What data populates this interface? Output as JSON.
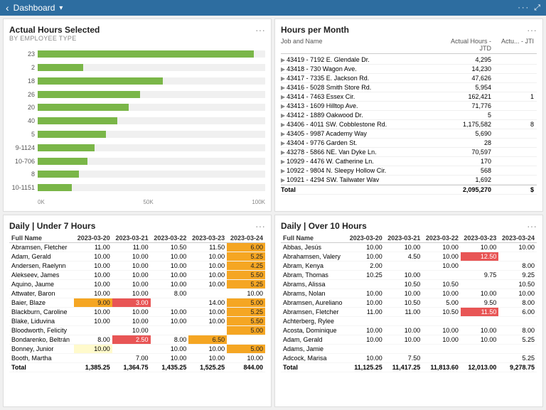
{
  "topbar": {
    "back": "‹",
    "title": "Dashboard",
    "chevron": "▾",
    "dots": "···",
    "expand": "⤢"
  },
  "actualHours": {
    "title": "Actual Hours Selected",
    "subtitle": "BY EMPLOYEE TYPE",
    "bars": [
      {
        "label": "23",
        "value": 95,
        "max": 100
      },
      {
        "label": "2",
        "value": 20,
        "max": 100
      },
      {
        "label": "18",
        "value": 55,
        "max": 100
      },
      {
        "label": "26",
        "value": 45,
        "max": 100
      },
      {
        "label": "20",
        "value": 40,
        "max": 100
      },
      {
        "label": "40",
        "value": 35,
        "max": 100
      },
      {
        "label": "5",
        "value": 30,
        "max": 100
      },
      {
        "label": "9-1124",
        "value": 25,
        "max": 100
      },
      {
        "label": "10-706",
        "value": 22,
        "max": 100
      },
      {
        "label": "8",
        "value": 18,
        "max": 100
      },
      {
        "label": "10-1151",
        "value": 15,
        "max": 100
      }
    ],
    "axis": [
      "0K",
      "50K",
      "100K"
    ]
  },
  "hoursPerMonth": {
    "title": "Hours per Month",
    "col1": "Job and Name",
    "col2": "Actual Hours - JTD",
    "col2short": "Actu... - JTD",
    "col3": "Actu... - JTI",
    "rows": [
      {
        "id": "43419",
        "name": "7192 E. Glendale Dr.",
        "actual": "4,295",
        "actu2": ""
      },
      {
        "id": "43418",
        "name": "730 Wagon Ave.",
        "actual": "14,230",
        "actu2": ""
      },
      {
        "id": "43417",
        "name": "7335 E. Jackson Rd.",
        "actual": "47,626",
        "actu2": ""
      },
      {
        "id": "43416",
        "name": "5028 Smith Store Rd.",
        "actual": "5,954",
        "actu2": ""
      },
      {
        "id": "43414",
        "name": "7463 Essex Cir.",
        "actual": "162,421",
        "actu2": "1"
      },
      {
        "id": "43413",
        "name": "1609 Hilltop Ave.",
        "actual": "71,776",
        "actu2": ""
      },
      {
        "id": "43412",
        "name": "1889 Oakwood Dr.",
        "actual": "5",
        "actu2": ""
      },
      {
        "id": "43406",
        "name": "4011 SW. Cobblestone Rd.",
        "actual": "1,175,582",
        "actu2": "8"
      },
      {
        "id": "43405",
        "name": "9987 Academy Way",
        "actual": "5,690",
        "actu2": ""
      },
      {
        "id": "43404",
        "name": "9776 Garden St.",
        "actual": "28",
        "actu2": ""
      },
      {
        "id": "43278",
        "name": "5866 NE. Van Dyke Ln.",
        "actual": "70,597",
        "actu2": ""
      },
      {
        "id": "10929",
        "name": "4476 W. Catherine Ln.",
        "actual": "170",
        "actu2": ""
      },
      {
        "id": "10922",
        "name": "9804 N. Sleepy Hollow Cir.",
        "actual": "568",
        "actu2": ""
      },
      {
        "id": "10921",
        "name": "4294 SW. Tailwater Wav",
        "actual": "1,692",
        "actu2": ""
      },
      {
        "id": "total",
        "name": "Total",
        "actual": "2,095,270",
        "actu2": "$",
        "isTotal": true
      }
    ]
  },
  "dailyUnder7": {
    "title": "Daily | Under 7 Hours",
    "cols": [
      "Full Name",
      "2023-03-20",
      "2023-03-21",
      "2023-03-22",
      "2023-03-23",
      "2023-03-24"
    ],
    "rows": [
      {
        "name": "Abramsen, Fletcher",
        "d20": "11.00",
        "d21": "11.00",
        "d22": "10.50",
        "d23": "11.50",
        "d24": "6.00",
        "d24hl": "orange"
      },
      {
        "name": "Adam, Gerald",
        "d20": "10.00",
        "d21": "10.00",
        "d22": "10.00",
        "d23": "10.00",
        "d24": "5.25",
        "d24hl": "orange"
      },
      {
        "name": "Andersen, Raelynn",
        "d20": "10.00",
        "d21": "10.00",
        "d22": "10.00",
        "d23": "10.00",
        "d24": "4.25",
        "d24hl": "orange"
      },
      {
        "name": "Alekseev, James",
        "d20": "10.00",
        "d21": "10.00",
        "d22": "10.00",
        "d23": "10.00",
        "d24": "5.50",
        "d24hl": "orange"
      },
      {
        "name": "Aquino, Jaume",
        "d20": "10.00",
        "d21": "10.00",
        "d22": "10.00",
        "d23": "10.00",
        "d24": "5.25",
        "d24hl": "orange"
      },
      {
        "name": "Attwater, Baron",
        "d20": "10.00",
        "d21": "10.00",
        "d22": "8.00",
        "d23": "",
        "d24": "10.00",
        "d24hl": ""
      },
      {
        "name": "Baier, Blaze",
        "d20": "9.00",
        "d20hl": "orange",
        "d21": "3.00",
        "d21hl": "red",
        "d22": "",
        "d23": "14.00",
        "d24": "5.00",
        "d24hl": "orange"
      },
      {
        "name": "Blackburn, Caroline",
        "d20": "10.00",
        "d21": "10.00",
        "d22": "10.00",
        "d23": "10.00",
        "d24": "5.25",
        "d24hl": "orange"
      },
      {
        "name": "Blake, Liduvina",
        "d20": "10.00",
        "d21": "10.00",
        "d22": "10.00",
        "d23": "10.00",
        "d24": "5.50",
        "d24hl": "orange"
      },
      {
        "name": "Bloodworth, Felicity",
        "d20": "",
        "d21": "10.00",
        "d22": "",
        "d23": "",
        "d24": "5.00",
        "d24hl": "orange"
      },
      {
        "name": "Bondarenko, Beltrán",
        "d20": "8.00",
        "d21": "2.50",
        "d21hl": "red",
        "d22": "8.00",
        "d23": "6.50",
        "d23hl": "orange",
        "d24": ""
      },
      {
        "name": "Bonney, Junior",
        "d20": "10.00",
        "d20hl": "yellow",
        "d21": "",
        "d22": "10.00",
        "d23": "10.00",
        "d24": "5.00",
        "d24hl": "orange"
      },
      {
        "name": "Booth, Martha",
        "d20": "",
        "d21": "7.00",
        "d22": "10.00",
        "d23": "10.00",
        "d24": "10.00"
      }
    ],
    "totals": {
      "label": "Total",
      "d20": "1,385.25",
      "d21": "1,364.75",
      "d22": "1,435.25",
      "d23": "1,525.25",
      "d24": "844.00"
    }
  },
  "dailyOver10": {
    "title": "Daily | Over 10 Hours",
    "cols": [
      "Full Name",
      "2023-03-20",
      "2023-03-21",
      "2023-03-22",
      "2023-03-23",
      "2023-03-24"
    ],
    "rows": [
      {
        "name": "Abbas, Jesús",
        "d20": "10.00",
        "d21": "10.00",
        "d22": "10.00",
        "d23": "10.00",
        "d24": "10.00"
      },
      {
        "name": "Abrahamsen, Valery",
        "d20": "10.00",
        "d21": "4.50",
        "d22": "10.00",
        "d23": "12.50",
        "d23hl": "red",
        "d24": ""
      },
      {
        "name": "Abram, Kenya",
        "d20": "2.00",
        "d21": "",
        "d22": "10.00",
        "d23": "",
        "d24": "8.00"
      },
      {
        "name": "Abram, Thomas",
        "d20": "10.25",
        "d21": "10.00",
        "d22": "",
        "d23": "9.75",
        "d24": "9.25"
      },
      {
        "name": "Abrams, Alissa",
        "d20": "",
        "d21": "10.50",
        "d22": "10.50",
        "d23": "",
        "d24": "10.50"
      },
      {
        "name": "Abrams, Nolan",
        "d20": "10.00",
        "d21": "10.00",
        "d22": "10.00",
        "d23": "10.00",
        "d24": "10.00"
      },
      {
        "name": "Abramsen, Aureliano",
        "d20": "10.00",
        "d21": "10.50",
        "d22": "5.00",
        "d23": "9.50",
        "d24": "8.00"
      },
      {
        "name": "Abramsen, Fletcher",
        "d20": "11.00",
        "d21": "11.00",
        "d22": "10.50",
        "d23": "11.50",
        "d23hl": "red",
        "d24": "6.00"
      },
      {
        "name": "Achterberg, Rylee",
        "d20": "",
        "d21": "",
        "d22": "",
        "d23": "",
        "d24": ""
      },
      {
        "name": "Acosta, Dominique",
        "d20": "10.00",
        "d21": "10.00",
        "d22": "10.00",
        "d23": "10.00",
        "d24": "8.00"
      },
      {
        "name": "Adam, Gerald",
        "d20": "10.00",
        "d21": "10.00",
        "d22": "10.00",
        "d23": "10.00",
        "d24": "5.25"
      },
      {
        "name": "Adams, Jamie",
        "d20": "",
        "d21": "",
        "d22": "",
        "d23": "",
        "d24": ""
      },
      {
        "name": "Adcock, Marisa",
        "d20": "10.00",
        "d21": "7.50",
        "d22": "",
        "d23": "",
        "d24": "5.25"
      }
    ],
    "totals": {
      "label": "Total",
      "d20": "11,125.25",
      "d21": "11,417.25",
      "d22": "11,813.60",
      "d23": "12,013.00",
      "d24": "9,278.75"
    }
  }
}
